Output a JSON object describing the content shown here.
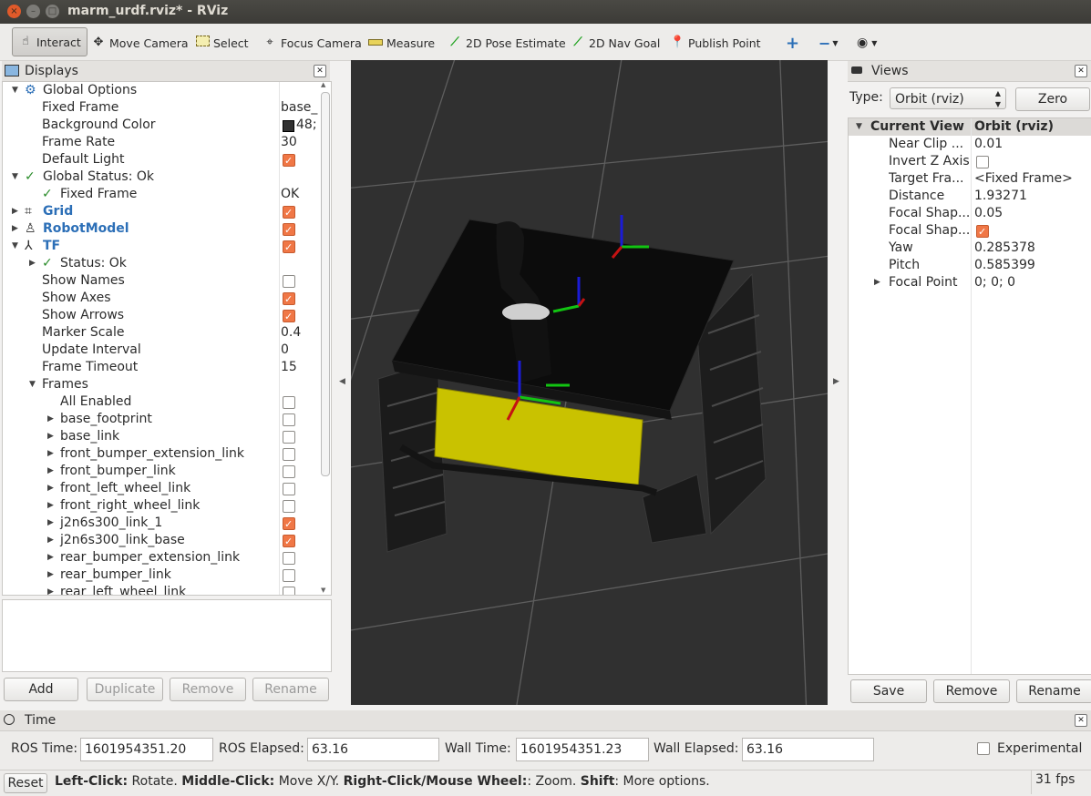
{
  "window": {
    "title": "marm_urdf.rviz* - RViz",
    "close_glyph": "×",
    "min_glyph": "–",
    "max_glyph": "□"
  },
  "toolbar": {
    "interact": "Interact",
    "move_camera": "Move Camera",
    "select": "Select",
    "focus_camera": "Focus Camera",
    "measure": "Measure",
    "pose_estimate": "2D Pose Estimate",
    "nav_goal": "2D Nav Goal",
    "publish_point": "Publish Point"
  },
  "displays": {
    "title": "Displays",
    "rows": [
      {
        "label": "Global Options",
        "indent": 0,
        "arrow": "▼",
        "icon": "gear-icon",
        "value": ""
      },
      {
        "label": "Fixed Frame",
        "indent": 1,
        "value": "base_"
      },
      {
        "label": "Background Color",
        "indent": 1,
        "value": "48;",
        "swatch": "#303030"
      },
      {
        "label": "Frame Rate",
        "indent": 1,
        "value": "30"
      },
      {
        "label": "Default Light",
        "indent": 1,
        "check": true
      },
      {
        "label": "Global Status: Ok",
        "indent": 0,
        "arrow": "▼",
        "icon": "checkmark-icon",
        "value": ""
      },
      {
        "label": "Fixed Frame",
        "indent": 1,
        "icon": "checkmark-icon",
        "value": "OK"
      },
      {
        "label": "Grid",
        "indent": 0,
        "arrow": "▶",
        "icon": "grid-icon",
        "blue": true,
        "check": true
      },
      {
        "label": "RobotModel",
        "indent": 0,
        "arrow": "▶",
        "icon": "robot-icon",
        "blue": true,
        "check": true
      },
      {
        "label": "TF",
        "indent": 0,
        "arrow": "▼",
        "icon": "axes-icon",
        "blue": true,
        "check": true
      },
      {
        "label": "Status: Ok",
        "indent": 1,
        "arrow": "▶",
        "icon": "checkmark-icon",
        "value": ""
      },
      {
        "label": "Show Names",
        "indent": 1,
        "check": false
      },
      {
        "label": "Show Axes",
        "indent": 1,
        "check": true
      },
      {
        "label": "Show Arrows",
        "indent": 1,
        "check": true
      },
      {
        "label": "Marker Scale",
        "indent": 1,
        "value": "0.4"
      },
      {
        "label": "Update Interval",
        "indent": 1,
        "value": "0"
      },
      {
        "label": "Frame Timeout",
        "indent": 1,
        "value": "15"
      },
      {
        "label": "Frames",
        "indent": 1,
        "arrow": "▼",
        "value": ""
      },
      {
        "label": "All Enabled",
        "indent": 2,
        "check": false
      },
      {
        "label": "base_footprint",
        "indent": 2,
        "arrow": "▶",
        "check": false
      },
      {
        "label": "base_link",
        "indent": 2,
        "arrow": "▶",
        "check": false
      },
      {
        "label": "front_bumper_extension_link",
        "indent": 2,
        "arrow": "▶",
        "check": false
      },
      {
        "label": "front_bumper_link",
        "indent": 2,
        "arrow": "▶",
        "check": false
      },
      {
        "label": "front_left_wheel_link",
        "indent": 2,
        "arrow": "▶",
        "check": false
      },
      {
        "label": "front_right_wheel_link",
        "indent": 2,
        "arrow": "▶",
        "check": false
      },
      {
        "label": "j2n6s300_link_1",
        "indent": 2,
        "arrow": "▶",
        "check": true
      },
      {
        "label": "j2n6s300_link_base",
        "indent": 2,
        "arrow": "▶",
        "check": true
      },
      {
        "label": "rear_bumper_extension_link",
        "indent": 2,
        "arrow": "▶",
        "check": false
      },
      {
        "label": "rear_bumper_link",
        "indent": 2,
        "arrow": "▶",
        "check": false
      },
      {
        "label": "rear_left_wheel_link",
        "indent": 2,
        "arrow": "▶",
        "check": false
      }
    ],
    "buttons": {
      "add": "Add",
      "duplicate": "Duplicate",
      "remove": "Remove",
      "rename": "Rename"
    }
  },
  "views": {
    "title": "Views",
    "type_label": "Type:",
    "type_value": "Orbit (rviz)",
    "zero_button": "Zero",
    "header_key": "Current View",
    "header_value": "Orbit (rviz)",
    "rows": [
      {
        "key": "Near Clip ...",
        "value": "0.01"
      },
      {
        "key": "Invert Z Axis",
        "check": false
      },
      {
        "key": "Target Fra...",
        "value": "<Fixed Frame>"
      },
      {
        "key": "Distance",
        "value": "1.93271"
      },
      {
        "key": "Focal Shap...",
        "value": "0.05"
      },
      {
        "key": "Focal Shap...",
        "check": true
      },
      {
        "key": "Yaw",
        "value": "0.285378"
      },
      {
        "key": "Pitch",
        "value": "0.585399"
      },
      {
        "key": "Focal Point",
        "value": "0; 0; 0",
        "arrow": "▶"
      }
    ],
    "buttons": {
      "save": "Save",
      "remove": "Remove",
      "rename": "Rename"
    }
  },
  "time": {
    "title": "Time",
    "ros_time_label": "ROS Time:",
    "ros_time": "1601954351.20",
    "ros_elapsed_label": "ROS Elapsed:",
    "ros_elapsed": "63.16",
    "wall_time_label": "Wall Time:",
    "wall_time": "1601954351.23",
    "wall_elapsed_label": "Wall Elapsed:",
    "wall_elapsed": "63.16",
    "experimental_label": "Experimental"
  },
  "status": {
    "reset": "Reset",
    "help_1b": "Left-Click:",
    "help_1": " Rotate. ",
    "help_2b": "Middle-Click:",
    "help_2": " Move X/Y. ",
    "help_3b": "Right-Click/Mouse Wheel:",
    "help_3": ": Zoom. ",
    "help_4b": "Shift",
    "help_4": ": More options.",
    "fps": "31 fps"
  }
}
